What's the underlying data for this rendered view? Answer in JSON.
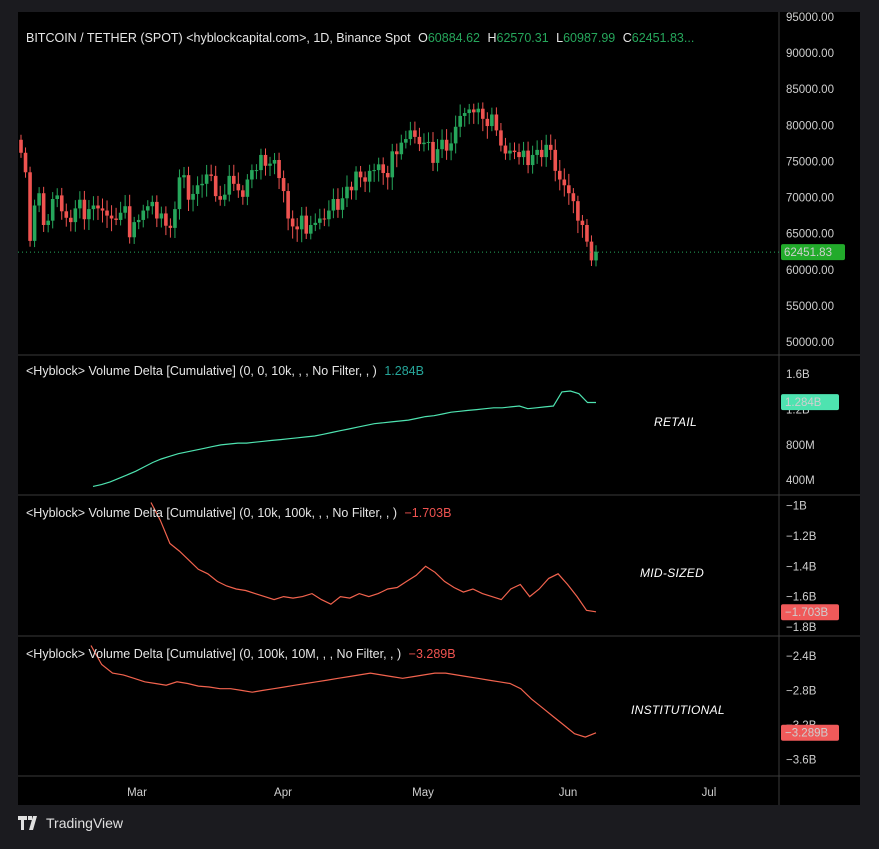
{
  "header": {
    "symbol": "BITCOIN / TETHER (SPOT) <hyblockcapital.com>, 1D, Binance Spot",
    "o_label": "O",
    "o_value": "60884.62",
    "h_label": "H",
    "h_value": "62570.31",
    "l_label": "L",
    "l_value": "60987.99",
    "c_label": "C",
    "c_value": "62451.83..."
  },
  "panes": {
    "retail": {
      "legend": "<Hyblock> Volume Delta [Cumulative] (0, 0, 10k, , , No Filter, , )",
      "value": "1.284B",
      "label": "RETAIL",
      "price_tag": "1.284B"
    },
    "mid": {
      "legend": "<Hyblock> Volume Delta [Cumulative] (0, 10k, 100k, , , No Filter, , )",
      "value": "−1.703B",
      "label": "MID-SIZED",
      "price_tag": "−1.703B"
    },
    "inst": {
      "legend": "<Hyblock> Volume Delta [Cumulative] (0, 100k, 10M, , , No Filter, , )",
      "value": "−3.289B",
      "label": "INSTITUTIONAL",
      "price_tag": "−3.289B"
    }
  },
  "price_tag": "62451.83",
  "footer": {
    "brand": "TradingView"
  },
  "colors": {
    "up": "#26a65b",
    "down": "#ef5350",
    "retail": "#4ee3b0",
    "mid": "#f2634e",
    "inst": "#f2634e",
    "tag_up": "#22ab2b",
    "tag_retail": "#4ee3b0",
    "tag_neg": "#f05a5a"
  },
  "chart_data": [
    {
      "type": "candlestick",
      "title": "BITCOIN / TETHER (SPOT), 1D, Binance Spot",
      "x_ticks": [
        "Mar",
        "Apr",
        "May",
        "Jun",
        "Jul"
      ],
      "y_ticks": [
        "95000.00",
        "90000.00",
        "85000.00",
        "80000.00",
        "75000.00",
        "70000.00",
        "65000.00",
        "60000.00",
        "55000.00",
        "50000.00"
      ],
      "ylim": [
        49000,
        96000
      ],
      "last_price": 62451.83,
      "close_series_daily_approx": [
        76200,
        73500,
        64000,
        68900,
        70600,
        66200,
        66800,
        69800,
        70300,
        68100,
        67200,
        66600,
        68500,
        69700,
        67000,
        68400,
        68900,
        68500,
        68200,
        67500,
        67100,
        66900,
        67900,
        68800,
        64500,
        66600,
        66900,
        68200,
        68800,
        69400,
        67100,
        67800,
        66100,
        65800,
        68400,
        72800,
        73100,
        69700,
        70500,
        71700,
        71900,
        73200,
        73000,
        70200,
        69700,
        70400,
        73000,
        71900,
        71000,
        70100,
        72500,
        73800,
        73800,
        75900,
        74400,
        74700,
        75200,
        72700,
        70900,
        67100,
        66000,
        65600,
        67500,
        65000,
        66200,
        66500,
        67100,
        67000,
        68200,
        69800,
        68300,
        69900,
        71500,
        71000,
        73600,
        72800,
        72200,
        73700,
        73800,
        74600,
        73400,
        72800,
        76400,
        76000,
        77600,
        78100,
        79300,
        78400,
        77400,
        77600,
        77700,
        74800,
        76700,
        78000,
        76500,
        77500,
        79800,
        81300,
        81700,
        82200,
        81800,
        82300,
        80900,
        79900,
        81500,
        79300,
        77200,
        76100,
        76500,
        76300,
        75600,
        76500,
        74500,
        75900,
        76600,
        75600,
        77300,
        76600,
        73700,
        72500,
        71700,
        70600,
        69500,
        66800,
        66200,
        63900,
        61300,
        62500
      ]
    },
    {
      "type": "line",
      "name": "RETAIL",
      "y_ticks": [
        "1.6B",
        "1.2B",
        "800M",
        "400M"
      ],
      "ylim": [
        0.3,
        1.75
      ],
      "last": 1.284,
      "values_billions_approx": [
        0.33,
        0.35,
        0.38,
        0.42,
        0.46,
        0.5,
        0.55,
        0.6,
        0.64,
        0.67,
        0.7,
        0.72,
        0.74,
        0.76,
        0.78,
        0.8,
        0.81,
        0.82,
        0.82,
        0.83,
        0.84,
        0.85,
        0.86,
        0.87,
        0.88,
        0.89,
        0.9,
        0.92,
        0.94,
        0.96,
        0.98,
        1.0,
        1.02,
        1.04,
        1.05,
        1.06,
        1.07,
        1.08,
        1.1,
        1.12,
        1.13,
        1.15,
        1.17,
        1.18,
        1.19,
        1.2,
        1.21,
        1.22,
        1.22,
        1.23,
        1.24,
        1.21,
        1.22,
        1.23,
        1.24,
        1.4,
        1.41,
        1.38,
        1.28,
        1.28
      ]
    },
    {
      "type": "line",
      "name": "MID-SIZED",
      "y_ticks": [
        "−1B",
        "−1.2B",
        "−1.4B",
        "−1.6B",
        "−1.8B"
      ],
      "ylim": [
        -1.82,
        -0.97
      ],
      "last": -1.703,
      "values_billions_approx": [
        -0.98,
        -1.1,
        -1.25,
        -1.3,
        -1.36,
        -1.42,
        -1.45,
        -1.5,
        -1.53,
        -1.55,
        -1.56,
        -1.58,
        -1.6,
        -1.62,
        -1.6,
        -1.61,
        -1.6,
        -1.58,
        -1.62,
        -1.65,
        -1.6,
        -1.61,
        -1.58,
        -1.6,
        -1.58,
        -1.55,
        -1.54,
        -1.5,
        -1.46,
        -1.4,
        -1.44,
        -1.5,
        -1.54,
        -1.57,
        -1.55,
        -1.58,
        -1.6,
        -1.62,
        -1.55,
        -1.52,
        -1.6,
        -1.55,
        -1.48,
        -1.45,
        -1.52,
        -1.6,
        -1.69,
        -1.7
      ]
    },
    {
      "type": "line",
      "name": "INSTITUTIONAL",
      "y_ticks": [
        "−2.4B",
        "−2.8B",
        "−3.2B",
        "−3.6B"
      ],
      "ylim": [
        -3.72,
        -2.24
      ],
      "last": -3.289,
      "values_billions_approx": [
        -2.28,
        -2.5,
        -2.6,
        -2.62,
        -2.66,
        -2.7,
        -2.72,
        -2.74,
        -2.7,
        -2.72,
        -2.75,
        -2.76,
        -2.78,
        -2.78,
        -2.8,
        -2.82,
        -2.8,
        -2.78,
        -2.76,
        -2.74,
        -2.72,
        -2.7,
        -2.68,
        -2.66,
        -2.64,
        -2.62,
        -2.6,
        -2.62,
        -2.64,
        -2.66,
        -2.64,
        -2.62,
        -2.6,
        -2.6,
        -2.62,
        -2.64,
        -2.66,
        -2.68,
        -2.7,
        -2.72,
        -2.78,
        -2.9,
        -3.0,
        -3.1,
        -3.2,
        -3.3,
        -3.34,
        -3.29
      ]
    }
  ]
}
